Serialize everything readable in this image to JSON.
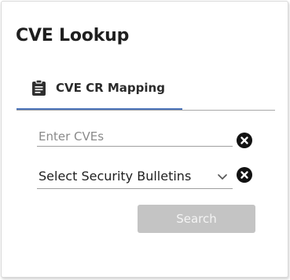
{
  "page": {
    "title": "CVE Lookup"
  },
  "tabs": [
    {
      "label": "CVE CR Mapping",
      "icon": "clipboard-icon",
      "active": true
    }
  ],
  "form": {
    "cve_input": {
      "placeholder": "Enter CVEs",
      "value": ""
    },
    "bulletin_select": {
      "selected": "Select Security Bulletins"
    },
    "search_label": "Search"
  },
  "colors": {
    "tab_underline": "#4a72b8",
    "search_button_disabled": "#c4c4c4",
    "clear_icon": "#121212"
  }
}
